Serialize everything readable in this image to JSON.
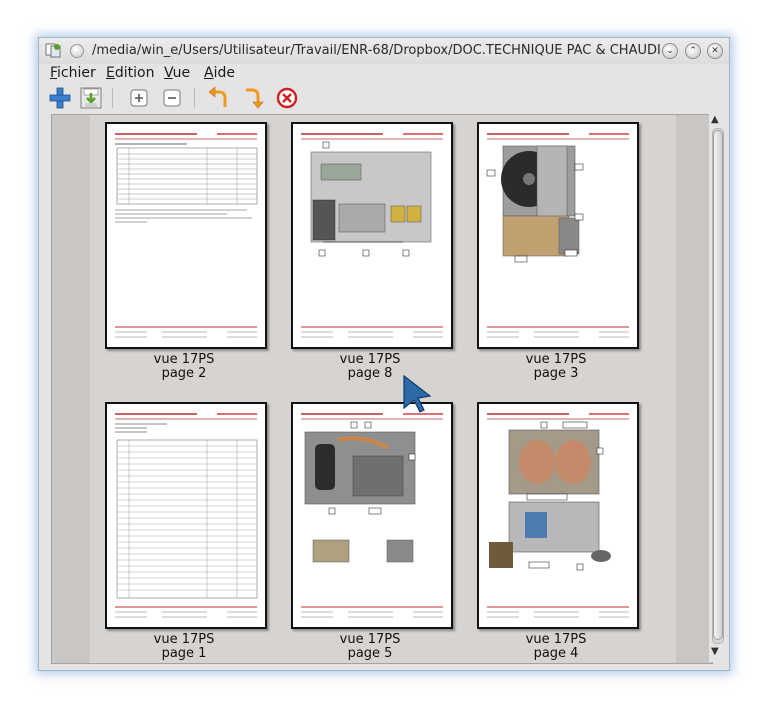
{
  "window": {
    "title": "/media/win_e/Users/Utilisateur/Travail/ENR-68/Dropbox/DOC.TECHNIQUE PAC & CHAUDIERES/Dim..."
  },
  "menubar": {
    "items": [
      {
        "label": "Fichier",
        "accel": "F",
        "rest": "ichier"
      },
      {
        "label": "Edition",
        "accel": "E",
        "rest": "dition"
      },
      {
        "label": "Vue",
        "accel": "V",
        "rest": "ue"
      },
      {
        "label": "Aide",
        "accel": "A",
        "rest": "ide"
      }
    ]
  },
  "toolbar": {
    "icons": [
      "add-icon",
      "save-icon",
      "zoom-in-icon",
      "zoom-out-icon",
      "rotate-left-icon",
      "rotate-right-icon",
      "delete-icon"
    ],
    "accent_colors": {
      "blue": "#3b7fd0",
      "orange": "#f09a20",
      "red": "#d02020",
      "green": "#5aa02a"
    }
  },
  "pages": [
    {
      "line1": "vue 17PS",
      "line2": "page 2"
    },
    {
      "line1": "vue 17PS",
      "line2": "page 8"
    },
    {
      "line1": "vue 17PS",
      "line2": "page 3"
    },
    {
      "line1": "vue 17PS",
      "line2": "page 1"
    },
    {
      "line1": "vue 17PS",
      "line2": "page 5"
    },
    {
      "line1": "vue 17PS",
      "line2": "page 4"
    }
  ]
}
